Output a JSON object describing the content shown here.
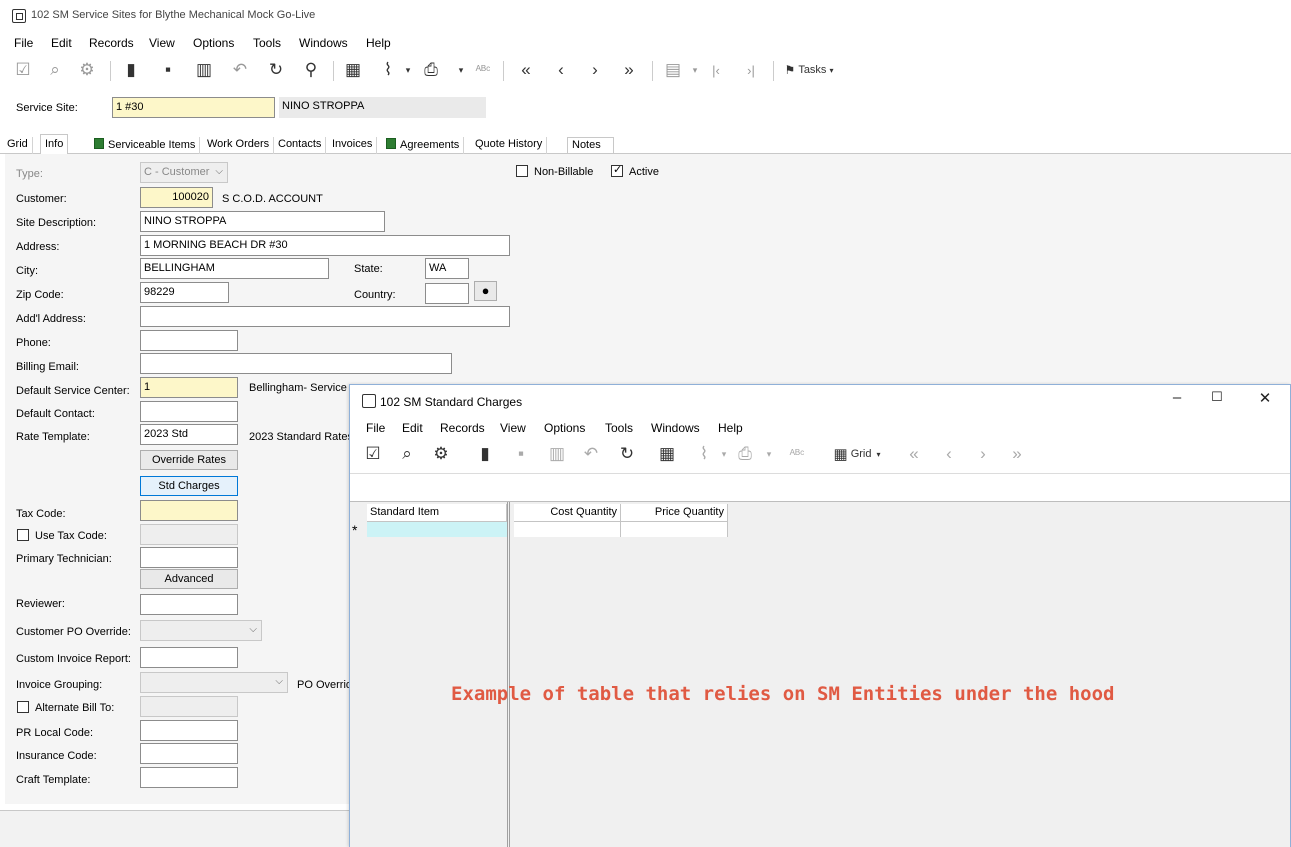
{
  "window": {
    "title": "102 SM Service Sites for Blythe Mechanical Mock Go-Live"
  },
  "menu": [
    "File",
    "Edit",
    "Records",
    "View",
    "Options",
    "Tools",
    "Windows",
    "Help"
  ],
  "toolbar": {
    "tasks_label": "Tasks"
  },
  "service_site": {
    "label": "Service Site:",
    "value": "1 #30",
    "description": "NINO STROPPA"
  },
  "tabs": [
    {
      "label": "Grid"
    },
    {
      "label": "Info"
    },
    {
      "label": "Serviceable Items"
    },
    {
      "label": "Work Orders"
    },
    {
      "label": "Contacts"
    },
    {
      "label": "Invoices"
    },
    {
      "label": "Agreements"
    },
    {
      "label": "Quote History"
    },
    {
      "label": "Notes"
    }
  ],
  "form": {
    "type": {
      "label": "Type:",
      "value": "C - Customer"
    },
    "non_billable": {
      "label": "Non-Billable",
      "checked": false
    },
    "active": {
      "label": "Active",
      "checked": true
    },
    "customer": {
      "label": "Customer:",
      "value": "100020",
      "name": "S C.O.D. ACCOUNT"
    },
    "site_description": {
      "label": "Site Description:",
      "value": "NINO STROPPA"
    },
    "address": {
      "label": "Address:",
      "value": "1 MORNING BEACH DR #30"
    },
    "city": {
      "label": "City:",
      "value": "BELLINGHAM"
    },
    "state": {
      "label": "State:",
      "value": "WA"
    },
    "zip": {
      "label": "Zip Code:",
      "value": "98229"
    },
    "country": {
      "label": "Country:",
      "value": ""
    },
    "addl_address": {
      "label": "Add'l Address:",
      "value": ""
    },
    "phone": {
      "label": "Phone:",
      "value": ""
    },
    "billing_email": {
      "label": "Billing Email:",
      "value": ""
    },
    "default_service_center": {
      "label": "Default Service Center:",
      "value": "1",
      "name": "Bellingham- Service"
    },
    "default_contact": {
      "label": "Default Contact:",
      "value": ""
    },
    "rate_template": {
      "label": "Rate Template:",
      "value": "2023 Std",
      "name": "2023 Standard Rates"
    },
    "override_rates_btn": "Override Rates",
    "std_charges_btn": "Std Charges",
    "tax_code": {
      "label": "Tax Code:",
      "value": ""
    },
    "use_tax_code": {
      "label": "Use Tax Code:",
      "checked": false
    },
    "primary_technician": {
      "label": "Primary Technician:",
      "value": ""
    },
    "advanced_btn": "Advanced",
    "reviewer": {
      "label": "Reviewer:",
      "value": ""
    },
    "customer_po_override": {
      "label": "Customer PO Override:",
      "value": ""
    },
    "custom_invoice_report": {
      "label": "Custom Invoice Report:",
      "value": ""
    },
    "invoice_grouping": {
      "label": "Invoice Grouping:",
      "value": "",
      "po_override_label": "PO Overrid"
    },
    "alternate_bill_to": {
      "label": "Alternate Bill To:",
      "checked": false
    },
    "pr_local_code": {
      "label": "PR Local Code:",
      "value": ""
    },
    "insurance_code": {
      "label": "Insurance Code:",
      "value": ""
    },
    "craft_template": {
      "label": "Craft Template:",
      "value": ""
    }
  },
  "child_window": {
    "title": "102 SM Standard Charges",
    "menu": [
      "File",
      "Edit",
      "Records",
      "View",
      "Options",
      "Tools",
      "Windows",
      "Help"
    ],
    "grid_label": "Grid",
    "columns": [
      "Standard Item",
      "Cost Quantity",
      "Price Quantity"
    ],
    "new_row_marker": "*"
  },
  "annotation": "Example of table that relies on SM Entities under the hood",
  "colors": {
    "accent": "#0078d7",
    "required_field": "#fdf7c9",
    "annotation": "#e05a43",
    "new_row": "#ccf3f6"
  }
}
